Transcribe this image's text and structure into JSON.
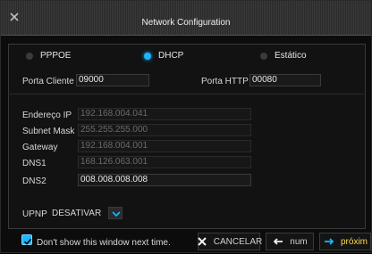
{
  "window": {
    "title": "Network Configuration"
  },
  "radio_options": [
    {
      "label": "PPPOE",
      "selected": false
    },
    {
      "label": "DHCP",
      "selected": true
    },
    {
      "label": "Estático",
      "selected": false
    }
  ],
  "ports": {
    "client_label": "Porta Cliente",
    "client_value": "09000",
    "http_label": "Porta HTTP",
    "http_value": "00080"
  },
  "network_fields": [
    {
      "label": "Endereço IP",
      "value": "192.168.004.041",
      "enabled": false
    },
    {
      "label": "Subnet Mask",
      "value": "255.255.255.000",
      "enabled": false
    },
    {
      "label": "Gateway",
      "value": "192.168.004.001",
      "enabled": false
    },
    {
      "label": "DNS1",
      "value": "168.126.063.001",
      "enabled": false
    },
    {
      "label": "DNS2",
      "value": "008.008.008.008",
      "enabled": true
    }
  ],
  "upnp": {
    "label": "UPNP",
    "value": "DESATIVAR"
  },
  "footer": {
    "dont_show_label": "Don't show this window next time.",
    "dont_show_checked": true,
    "cancel_label": "CANCELAR",
    "prev_label": "num",
    "next_label": "próxim"
  },
  "colors": {
    "accent": "#1ab7ff",
    "highlight_text": "#ffd84a"
  },
  "icons": {
    "close": "close-icon",
    "cancel": "x-icon",
    "prev": "left-arrow-icon",
    "next": "right-arrow-icon",
    "dropdown": "chevron-down-icon"
  }
}
